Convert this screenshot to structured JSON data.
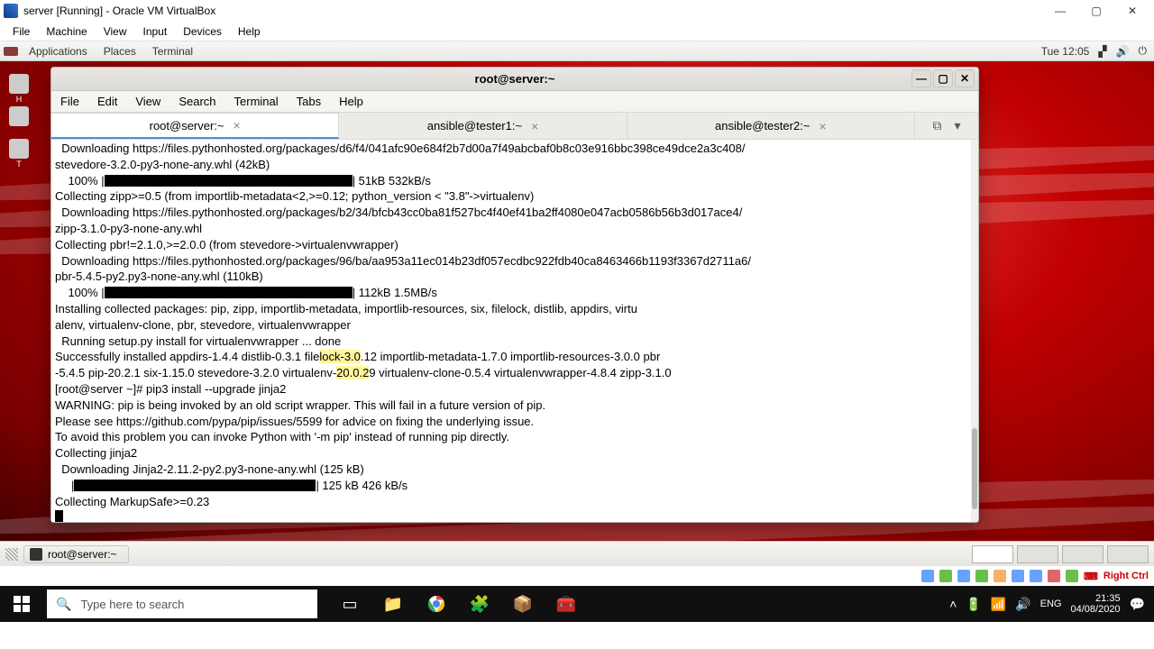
{
  "vbox": {
    "title": "server [Running] - Oracle VM VirtualBox",
    "menu": {
      "file": "File",
      "machine": "Machine",
      "view": "View",
      "input": "Input",
      "devices": "Devices",
      "help": "Help"
    },
    "right_ctrl": "Right Ctrl"
  },
  "gnome": {
    "menu": {
      "applications": "Applications",
      "places": "Places",
      "terminal": "Terminal"
    },
    "clock": "Tue 12:05"
  },
  "desktop_icons": {
    "i0": "H",
    "i1": "",
    "i2": "T"
  },
  "terminal": {
    "title": "root@server:~",
    "menu": {
      "file": "File",
      "edit": "Edit",
      "view": "View",
      "search": "Search",
      "terminal": "Terminal",
      "tabs": "Tabs",
      "help": "Help"
    },
    "tabs": [
      {
        "label": "root@server:~"
      },
      {
        "label": "ansible@tester1:~"
      },
      {
        "label": "ansible@tester2:~"
      }
    ],
    "lines": {
      "l0": "  Downloading https://files.pythonhosted.org/packages/d6/f4/041afc90e684f2b7d00a7f49abcbaf0b8c03e916bbc398ce49dce2a3c408/",
      "l1": "stevedore-3.2.0-py3-none-any.whl (42kB)",
      "l2a": "    100% |",
      "l2b": "| 51kB 532kB/s",
      "l3": "Collecting zipp>=0.5 (from importlib-metadata<2,>=0.12; python_version < \"3.8\"->virtualenv)",
      "l4": "  Downloading https://files.pythonhosted.org/packages/b2/34/bfcb43cc0ba81f527bc4f40ef41ba2ff4080e047acb0586b56b3d017ace4/",
      "l5": "zipp-3.1.0-py3-none-any.whl",
      "l6": "Collecting pbr!=2.1.0,>=2.0.0 (from stevedore->virtualenvwrapper)",
      "l7": "  Downloading https://files.pythonhosted.org/packages/96/ba/aa953a11ec014b23df057ecdbc922fdb40ca8463466b1193f3367d2711a6/",
      "l8": "pbr-5.4.5-py2.py3-none-any.whl (110kB)",
      "l9a": "    100% |",
      "l9b": "| 112kB 1.5MB/s",
      "l10": "Installing collected packages: pip, zipp, importlib-metadata, importlib-resources, six, filelock, distlib, appdirs, virtu",
      "l11": "alenv, virtualenv-clone, pbr, stevedore, virtualenvwrapper",
      "l12": "  Running setup.py install for virtualenvwrapper ... done",
      "l13a": "Successfully installed appdirs-1.4.4 distlib-0.3.1 file",
      "l13hl": "lock-3.0",
      "l13b": ".12 importlib-metadata-1.7.0 importlib-resources-3.0.0 pbr",
      "l14a": "-5.4.5 pip-20.2.1 six-1.15.0 stevedore-3.2.0 virtualenv-",
      "l14hl": "20.0.2",
      "l14b": "9 virtualenv-clone-0.5.4 virtualenvwrapper-4.8.4 zipp-3.1.0",
      "l15": "[root@server ~]# pip3 install --upgrade jinja2",
      "l16": "WARNING: pip is being invoked by an old script wrapper. This will fail in a future version of pip.",
      "l17": "Please see https://github.com/pypa/pip/issues/5599 for advice on fixing the underlying issue.",
      "l18": "To avoid this problem you can invoke Python with '-m pip' instead of running pip directly.",
      "l19": "Collecting jinja2",
      "l20": "  Downloading Jinja2-2.11.2-py2.py3-none-any.whl (125 kB)",
      "l21a": "     |",
      "l21b": "| 125 kB 426 kB/s",
      "l22": "Collecting MarkupSafe>=0.23"
    }
  },
  "guest_taskbar": {
    "app": "root@server:~"
  },
  "win": {
    "search_placeholder": "Type here to search",
    "lang": "ENG",
    "time": "21:35",
    "date": "04/08/2020"
  }
}
